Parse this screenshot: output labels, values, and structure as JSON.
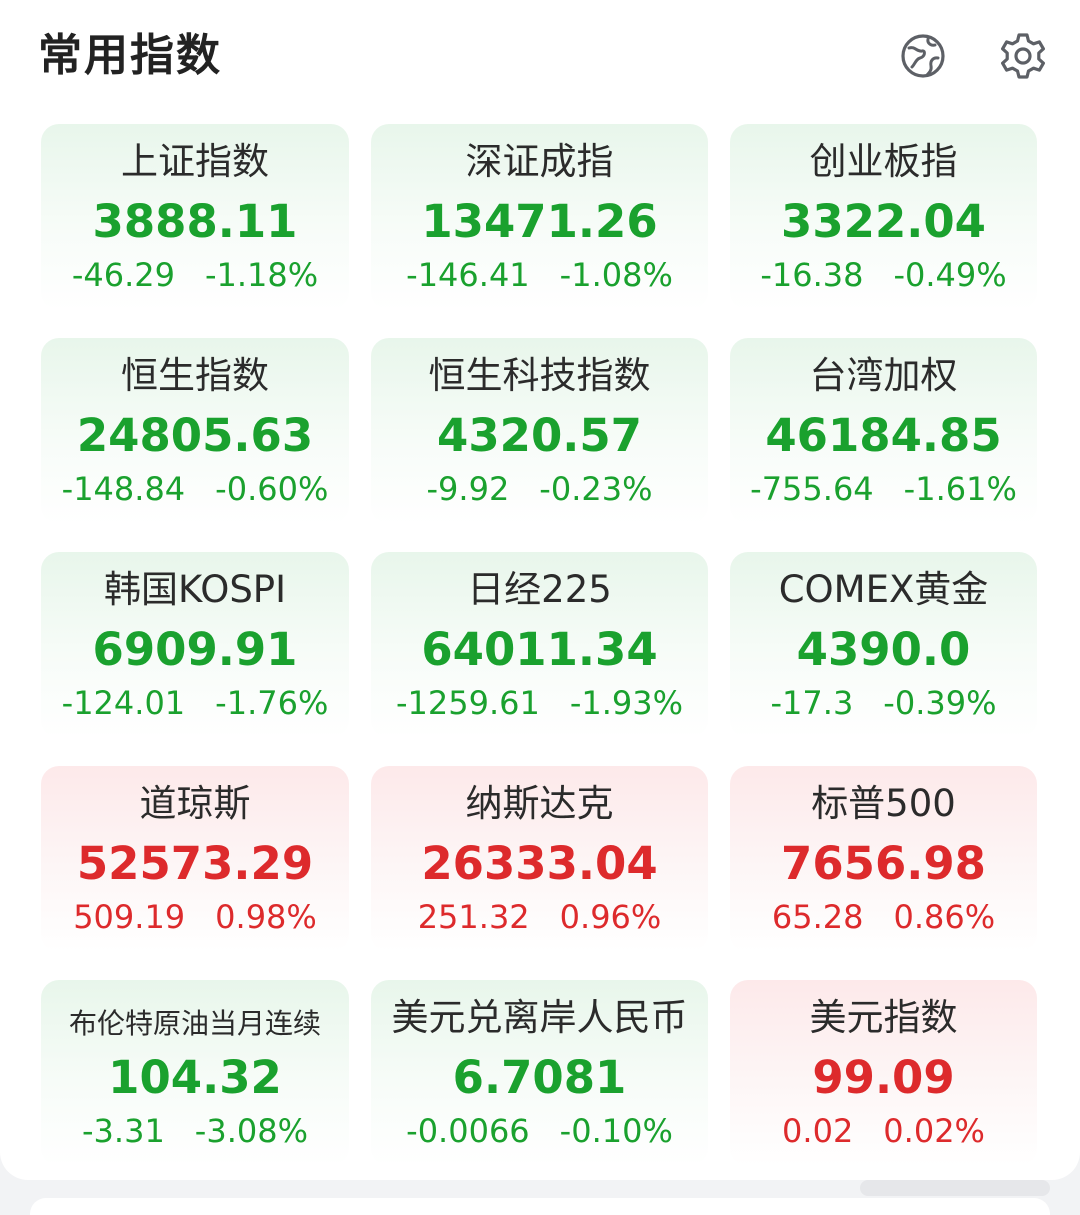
{
  "header": {
    "title": "常用指数"
  },
  "colors": {
    "down": "#1aa12e",
    "up": "#dd2a2c"
  },
  "icons": {
    "globe": "globe-icon",
    "settings": "gear-icon"
  },
  "cards": [
    {
      "name": "上证指数",
      "value": "3888.11",
      "change": "-46.29",
      "pct": "-1.18%",
      "trend": "down"
    },
    {
      "name": "深证成指",
      "value": "13471.26",
      "change": "-146.41",
      "pct": "-1.08%",
      "trend": "down"
    },
    {
      "name": "创业板指",
      "value": "3322.04",
      "change": "-16.38",
      "pct": "-0.49%",
      "trend": "down"
    },
    {
      "name": "恒生指数",
      "value": "24805.63",
      "change": "-148.84",
      "pct": "-0.60%",
      "trend": "down"
    },
    {
      "name": "恒生科技指数",
      "value": "4320.57",
      "change": "-9.92",
      "pct": "-0.23%",
      "trend": "down"
    },
    {
      "name": "台湾加权",
      "value": "46184.85",
      "change": "-755.64",
      "pct": "-1.61%",
      "trend": "down"
    },
    {
      "name": "韩国KOSPI",
      "value": "6909.91",
      "change": "-124.01",
      "pct": "-1.76%",
      "trend": "down"
    },
    {
      "name": "日经225",
      "value": "64011.34",
      "change": "-1259.61",
      "pct": "-1.93%",
      "trend": "down"
    },
    {
      "name": "COMEX黄金",
      "value": "4390.0",
      "change": "-17.3",
      "pct": "-0.39%",
      "trend": "down"
    },
    {
      "name": "道琼斯",
      "value": "52573.29",
      "change": "509.19",
      "pct": "0.98%",
      "trend": "up"
    },
    {
      "name": "纳斯达克",
      "value": "26333.04",
      "change": "251.32",
      "pct": "0.96%",
      "trend": "up"
    },
    {
      "name": "标普500",
      "value": "7656.98",
      "change": "65.28",
      "pct": "0.86%",
      "trend": "up"
    },
    {
      "name": "布伦特原油当月连续",
      "value": "104.32",
      "change": "-3.31",
      "pct": "-3.08%",
      "trend": "down"
    },
    {
      "name": "美元兑离岸人民币",
      "value": "6.7081",
      "change": "-0.0066",
      "pct": "-0.10%",
      "trend": "down"
    },
    {
      "name": "美元指数",
      "value": "99.09",
      "change": "0.02",
      "pct": "0.02%",
      "trend": "up"
    }
  ]
}
